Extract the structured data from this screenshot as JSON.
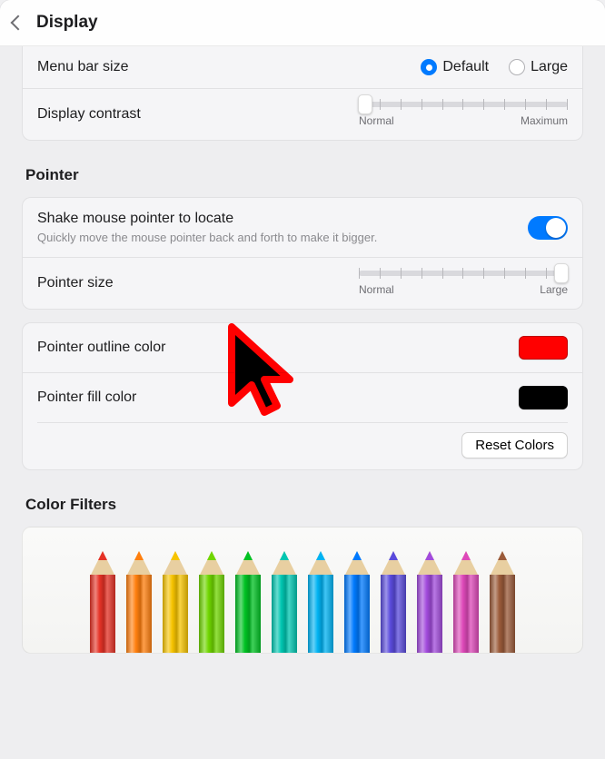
{
  "header": {
    "title": "Display"
  },
  "menu_bar_size": {
    "label": "Menu bar size",
    "options": {
      "default": "Default",
      "large": "Large"
    },
    "selected": "default"
  },
  "display_contrast": {
    "label": "Display contrast",
    "min_label": "Normal",
    "max_label": "Maximum",
    "value_pct": 3
  },
  "pointer_section": "Pointer",
  "shake": {
    "label": "Shake mouse pointer to locate",
    "sub": "Quickly move the mouse pointer back and forth to make it bigger.",
    "on": true
  },
  "pointer_size": {
    "label": "Pointer size",
    "min_label": "Normal",
    "max_label": "Large",
    "value_pct": 97
  },
  "pointer_outline": {
    "label": "Pointer outline color",
    "color": "#ff0000"
  },
  "pointer_fill": {
    "label": "Pointer fill color",
    "color": "#000000"
  },
  "reset_colors": "Reset Colors",
  "color_filters_section": "Color Filters",
  "pencils": [
    "#e53226",
    "#ff7f0e",
    "#f7c400",
    "#70d600",
    "#00c223",
    "#00c6b1",
    "#00b3f3",
    "#007aff",
    "#5a4bdc",
    "#a24bdc",
    "#de49b9",
    "#9b5b3a"
  ]
}
